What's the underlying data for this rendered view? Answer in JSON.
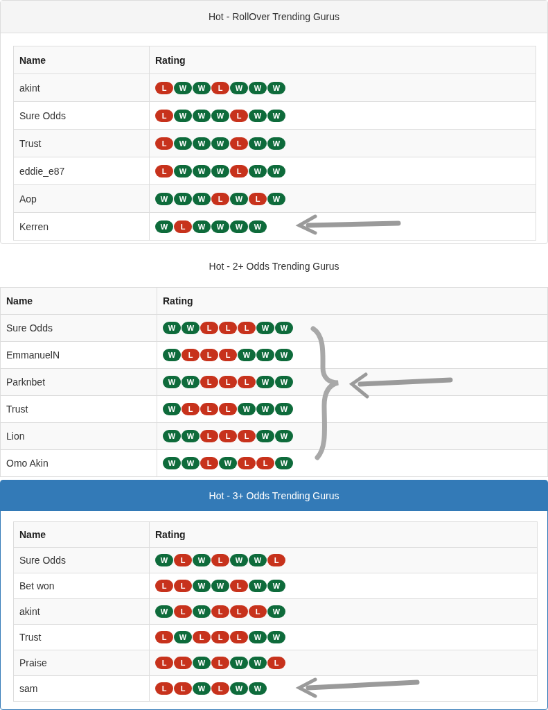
{
  "panels": [
    {
      "title": "Hot - RollOver Trending Gurus",
      "kind": "boxed",
      "columns": [
        "Name",
        "Rating"
      ],
      "rows": [
        {
          "name": "akint",
          "results": [
            "L",
            "W",
            "W",
            "L",
            "W",
            "W",
            "W"
          ]
        },
        {
          "name": "Sure Odds",
          "results": [
            "L",
            "W",
            "W",
            "W",
            "L",
            "W",
            "W"
          ]
        },
        {
          "name": "Trust",
          "results": [
            "L",
            "W",
            "W",
            "W",
            "L",
            "W",
            "W"
          ]
        },
        {
          "name": "eddie_e87",
          "results": [
            "L",
            "W",
            "W",
            "W",
            "L",
            "W",
            "W"
          ]
        },
        {
          "name": "Aop",
          "results": [
            "W",
            "W",
            "W",
            "L",
            "W",
            "L",
            "W"
          ]
        },
        {
          "name": "Kerren",
          "results": [
            "W",
            "L",
            "W",
            "W",
            "W",
            "W"
          ]
        }
      ]
    },
    {
      "title": "Hot - 2+ Odds Trending Gurus",
      "kind": "plain",
      "columns": [
        "Name",
        "Rating"
      ],
      "rows": [
        {
          "name": "Sure Odds",
          "results": [
            "W",
            "W",
            "L",
            "L",
            "L",
            "W",
            "W"
          ]
        },
        {
          "name": "EmmanuelN",
          "results": [
            "W",
            "L",
            "L",
            "L",
            "W",
            "W",
            "W"
          ]
        },
        {
          "name": "Parknbet",
          "results": [
            "W",
            "W",
            "L",
            "L",
            "L",
            "W",
            "W"
          ]
        },
        {
          "name": "Trust",
          "results": [
            "W",
            "L",
            "L",
            "L",
            "W",
            "W",
            "W"
          ]
        },
        {
          "name": "Lion",
          "results": [
            "W",
            "W",
            "L",
            "L",
            "L",
            "W",
            "W"
          ]
        },
        {
          "name": "Omo Akin",
          "results": [
            "W",
            "W",
            "L",
            "W",
            "L",
            "L",
            "W"
          ]
        }
      ]
    },
    {
      "title": "Hot - 3+ Odds Trending Gurus",
      "kind": "primary",
      "columns": [
        "Name",
        "Rating"
      ],
      "rows": [
        {
          "name": "Sure Odds",
          "results": [
            "W",
            "L",
            "W",
            "L",
            "W",
            "W",
            "L"
          ]
        },
        {
          "name": "Bet won",
          "results": [
            "L",
            "L",
            "W",
            "W",
            "L",
            "W",
            "W"
          ]
        },
        {
          "name": "akint",
          "results": [
            "W",
            "L",
            "W",
            "L",
            "L",
            "L",
            "W"
          ]
        },
        {
          "name": "Trust",
          "results": [
            "L",
            "W",
            "L",
            "L",
            "L",
            "W",
            "W"
          ]
        },
        {
          "name": "Praise",
          "results": [
            "L",
            "L",
            "W",
            "L",
            "W",
            "W",
            "L"
          ]
        },
        {
          "name": "sam",
          "results": [
            "L",
            "L",
            "W",
            "L",
            "W",
            "W"
          ]
        }
      ]
    }
  ]
}
